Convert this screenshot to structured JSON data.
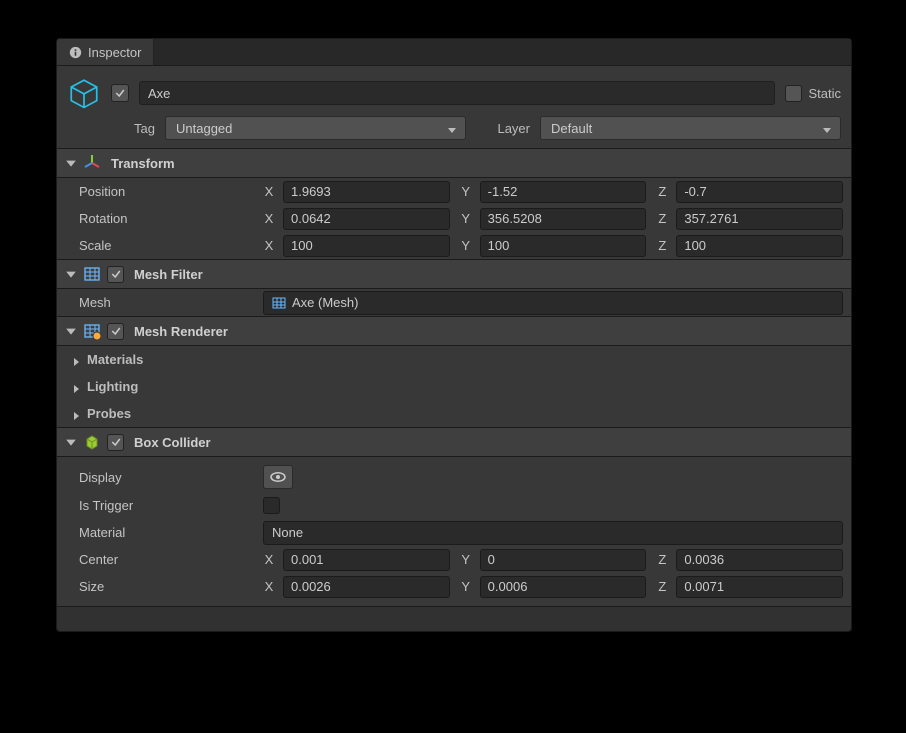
{
  "tab": {
    "label": "Inspector"
  },
  "header": {
    "active_checked": true,
    "name": "Axe",
    "static_checked": false,
    "static_label": "Static",
    "tag_label": "Tag",
    "tag_value": "Untagged",
    "layer_label": "Layer",
    "layer_value": "Default"
  },
  "transform": {
    "title": "Transform",
    "position": {
      "label": "Position",
      "x": "1.9693",
      "y": "-1.52",
      "z": "-0.7"
    },
    "rotation": {
      "label": "Rotation",
      "x": "0.0642",
      "y": "356.5208",
      "z": "357.2761"
    },
    "scale": {
      "label": "Scale",
      "x": "100",
      "y": "100",
      "z": "100"
    }
  },
  "mesh_filter": {
    "title": "Mesh Filter",
    "enabled": true,
    "mesh_label": "Mesh",
    "mesh_value": "Axe (Mesh)"
  },
  "mesh_renderer": {
    "title": "Mesh Renderer",
    "enabled": true,
    "sections": {
      "materials": "Materials",
      "lighting": "Lighting",
      "probes": "Probes"
    }
  },
  "box_collider": {
    "title": "Box Collider",
    "enabled": true,
    "display_label": "Display",
    "is_trigger_label": "Is Trigger",
    "is_trigger_checked": false,
    "material_label": "Material",
    "material_value": "None",
    "center": {
      "label": "Center",
      "x": "0.001",
      "y": "0",
      "z": "0.0036"
    },
    "size": {
      "label": "Size",
      "x": "0.0026",
      "y": "0.0006",
      "z": "0.0071"
    }
  },
  "axis": {
    "x": "X",
    "y": "Y",
    "z": "Z"
  }
}
